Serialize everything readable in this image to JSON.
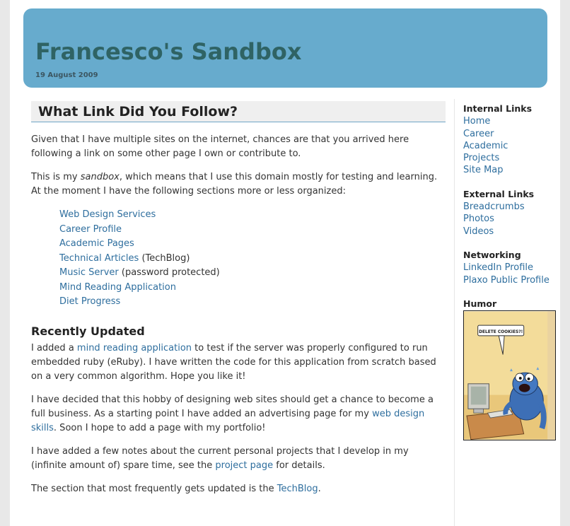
{
  "header": {
    "title": "Francesco's Sandbox",
    "date": "19 August 2009"
  },
  "main": {
    "heading": "What Link Did You Follow?",
    "intro": "Given that I have multiple sites on the internet, chances are that you arrived here following a link on some other page I own or contribute to.",
    "sandbox_before": "This is my ",
    "sandbox_em": "sandbox",
    "sandbox_after": ", which means that I use this domain mostly for testing and learning. At the moment I have the following sections more or less organized:",
    "sections": [
      {
        "link": "Web Design Services",
        "suffix": ""
      },
      {
        "link": "Career Profile",
        "suffix": ""
      },
      {
        "link": "Academic Pages",
        "suffix": ""
      },
      {
        "link": "Technical Articles",
        "suffix": " (TechBlog)"
      },
      {
        "link": "Music Server",
        "suffix": " (password protected)"
      },
      {
        "link": "Mind Reading Application",
        "suffix": ""
      },
      {
        "link": "Diet Progress",
        "suffix": ""
      }
    ],
    "recent_heading": "Recently Updated",
    "p1_before": "I added a ",
    "p1_link": "mind reading application",
    "p1_after": " to test if the server was properly configured to run embedded ruby (eRuby). I have written the code for this application from scratch based on a very common algorithm. Hope you like it!",
    "p2_before": "I have decided that this hobby of designing web sites should get a chance to become a full business. As a starting point I have added an advertising page for my ",
    "p2_link": "web design skills",
    "p2_after": ". Soon I hope to add a page with my portfolio!",
    "p3_before": "I have added a few notes about the current personal projects that I develop in my (infinite amount of) spare time, see the ",
    "p3_link": "project page",
    "p3_after": " for details.",
    "p4_before": "The section that most frequently gets updated is the ",
    "p4_link": "TechBlog",
    "p4_after": "."
  },
  "sidebar": {
    "internal_heading": "Internal Links",
    "internal": [
      "Home",
      "Career",
      "Academic",
      "Projects",
      "Site Map"
    ],
    "external_heading": "External Links",
    "external": [
      "Breadcrumbs",
      "Photos",
      "Videos"
    ],
    "networking_heading": "Networking",
    "networking": [
      "LinkedIn Profile",
      "Plaxo Public Profile"
    ],
    "humor_heading": "Humor",
    "comic_caption": "DELETE COOKIES?!"
  },
  "colors": {
    "header_bg": "#67abcd",
    "title": "#2f6364",
    "link": "#2e6e9e"
  }
}
